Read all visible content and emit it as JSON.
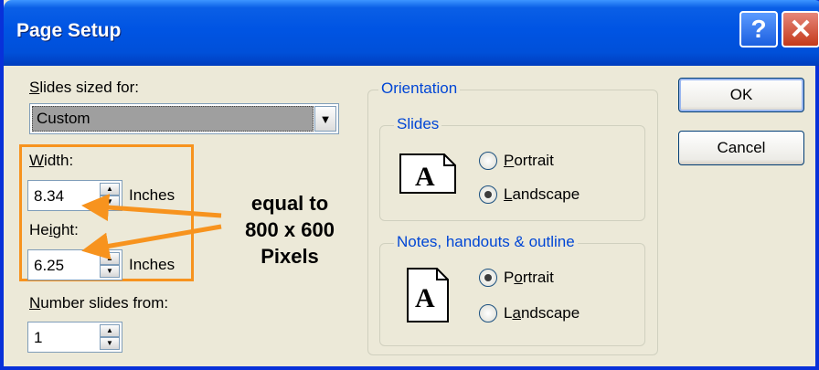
{
  "window": {
    "title": "Page Setup",
    "help_label": "?",
    "close_label": "✕"
  },
  "size": {
    "label_pre": "",
    "label_u": "S",
    "label_post": "lides sized for:",
    "value": "Custom"
  },
  "width": {
    "label_u": "W",
    "label_post": "idth:",
    "value": "8.34",
    "unit": "Inches"
  },
  "height": {
    "label_pre": "He",
    "label_u": "i",
    "label_post": "ght:",
    "value": "6.25",
    "unit": "Inches"
  },
  "number": {
    "label_u": "N",
    "label_post": "umber slides from:",
    "value": "1"
  },
  "annotation": {
    "line1": "equal to",
    "line2": "800 x 600",
    "line3": "Pixels",
    "color": "#f7931e"
  },
  "orientation": {
    "title": "Orientation",
    "slides": {
      "title": "Slides",
      "portrait_u": "P",
      "portrait_post": "ortrait",
      "landscape_u": "L",
      "landscape_post": "andscape",
      "selected": "landscape"
    },
    "notes": {
      "title": "Notes, handouts & outline",
      "portrait_pre": "P",
      "portrait_u": "o",
      "portrait_post": "rtrait",
      "landscape_pre": "L",
      "landscape_u": "a",
      "landscape_post": "ndscape",
      "selected": "portrait"
    }
  },
  "buttons": {
    "ok": "OK",
    "cancel": "Cancel"
  }
}
